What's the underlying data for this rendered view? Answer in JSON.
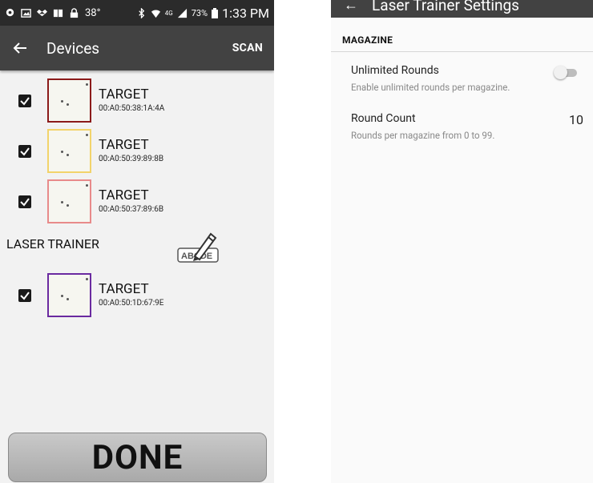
{
  "status_bar": {
    "temperature": "38°",
    "battery": "73%",
    "network": "4G",
    "time": "1:33 PM"
  },
  "left": {
    "app_bar": {
      "title": "Devices",
      "scan_label": "SCAN"
    },
    "devices_top": [
      {
        "name": "TARGET",
        "mac": "00:A0:50:38:1A:4A",
        "border_color": "#8b1a1a",
        "checked": true
      },
      {
        "name": "TARGET",
        "mac": "00:A0:50:39:89:8B",
        "border_color": "#f2d36b",
        "checked": true
      },
      {
        "name": "TARGET",
        "mac": "00:A0:50:37:89:6B",
        "border_color": "#e88a8a",
        "checked": true
      }
    ],
    "group_label": "LASER TRAINER",
    "edit_icon_caption": "ABCDE",
    "devices_group": [
      {
        "name": "TARGET",
        "mac": "00:A0:50:1D:67:9E",
        "border_color": "#6a2aa0",
        "checked": true
      }
    ],
    "done_label": "DONE"
  },
  "right": {
    "app_bar_title": "Laser Trainer Settings",
    "section_header": "MAGAZINE",
    "prefs": [
      {
        "title": "Unlimited Rounds",
        "subtitle": "Enable unlimited rounds per magazine.",
        "toggle_on": false
      },
      {
        "title": "Round Count",
        "subtitle": "Rounds per magazine from 0 to 99.",
        "value": "10"
      }
    ]
  }
}
